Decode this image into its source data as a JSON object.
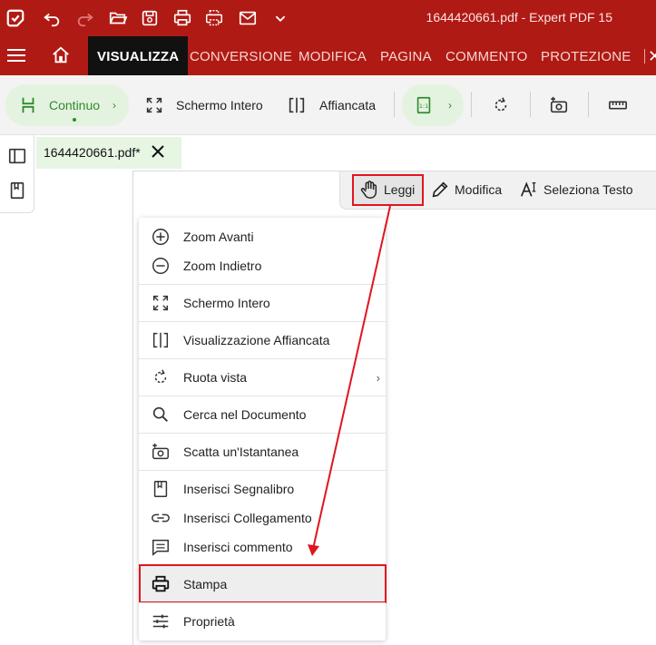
{
  "window": {
    "title": "1644420661.pdf   -   Expert PDF 15"
  },
  "quick_access": {
    "icons": [
      "app-logo-icon",
      "undo-icon",
      "redo-icon",
      "open-folder-icon",
      "save-icon",
      "print-icon",
      "batch-print-icon",
      "email-icon",
      "chevron-down-icon"
    ]
  },
  "ribbon": {
    "tabs": [
      {
        "label": "VISUALIZZA",
        "active": true
      },
      {
        "label": "CONVERSIONE",
        "active": false
      },
      {
        "label": "MODIFICA",
        "active": false
      },
      {
        "label": "PAGINA",
        "active": false
      },
      {
        "label": "COMMENTO",
        "active": false
      },
      {
        "label": "PROTEZIONE",
        "active": false
      }
    ]
  },
  "toolbar": {
    "continuo_label": "Continuo",
    "fullscreen_label": "Schermo Intero",
    "side_by_side_label": "Affiancata"
  },
  "document": {
    "tab_name": "1644420661.pdf*"
  },
  "modes": {
    "read_label": "Leggi",
    "edit_label": "Modifica",
    "select_text_label": "Seleziona Testo"
  },
  "context_menu": {
    "items": [
      {
        "label": "Zoom Avanti",
        "icon": "zoom-in-icon"
      },
      {
        "label": "Zoom Indietro",
        "icon": "zoom-out-icon"
      },
      {
        "label": "Schermo Intero",
        "icon": "fullscreen-icon"
      },
      {
        "label": "Visualizzazione Affiancata",
        "icon": "side-by-side-icon"
      },
      {
        "label": "Ruota vista",
        "icon": "rotate-icon"
      },
      {
        "label": "Cerca nel Documento",
        "icon": "search-icon"
      },
      {
        "label": "Scatta un'Istantanea",
        "icon": "snapshot-icon"
      },
      {
        "label": "Inserisci Segnalibro",
        "icon": "bookmark-icon"
      },
      {
        "label": "Inserisci Collegamento",
        "icon": "link-icon"
      },
      {
        "label": "Inserisci commento",
        "icon": "comment-icon"
      },
      {
        "label": "Stampa",
        "icon": "print-icon"
      },
      {
        "label": "Proprietà",
        "icon": "properties-icon"
      }
    ]
  },
  "colors": {
    "brand_red": "#b01a14",
    "highlight_red": "#e0151f",
    "active_tab": "#111111",
    "pill_green": "#e4f3df",
    "accent_green": "#2e8b2e"
  }
}
